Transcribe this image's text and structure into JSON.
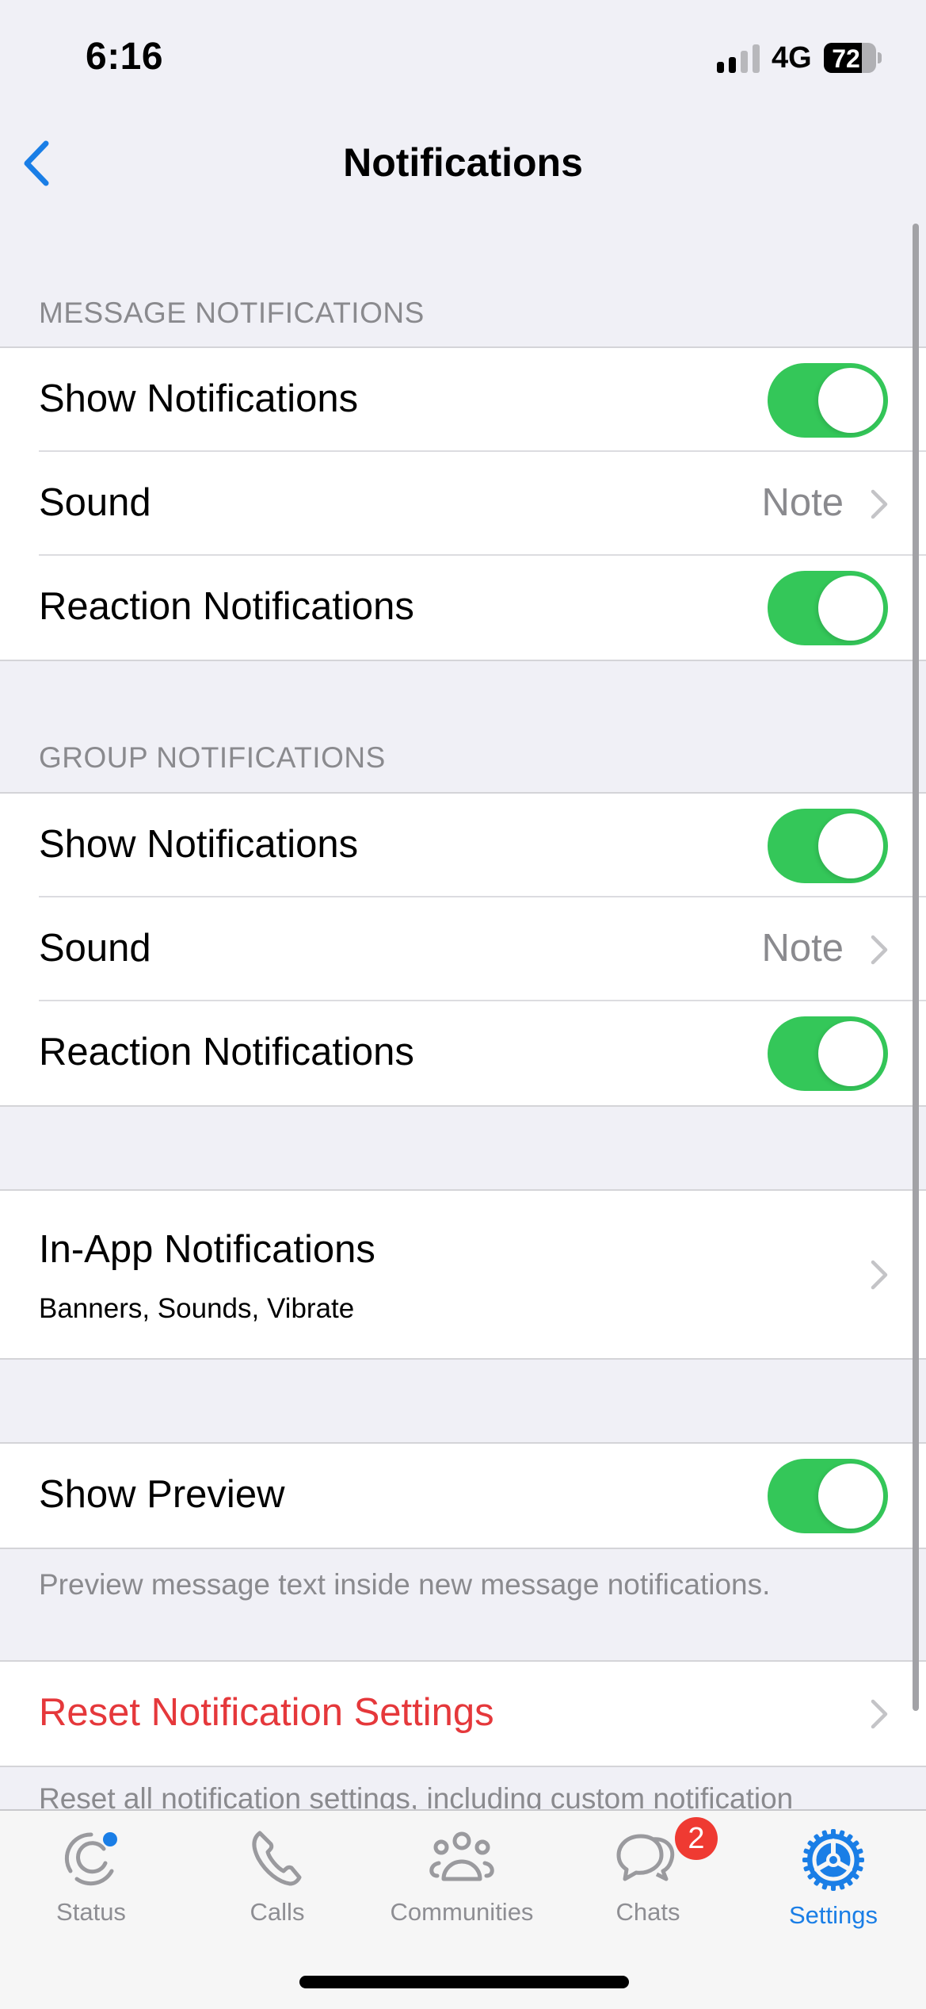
{
  "status_bar": {
    "time": "6:16",
    "network": "4G",
    "signal_bars_active": 2,
    "signal_bars_total": 4,
    "battery_percent": 72,
    "battery_label": "72"
  },
  "nav": {
    "back_icon": "chevron-left-icon",
    "title": "Notifications"
  },
  "colors": {
    "accent": "#1a7ee6",
    "toggle_on": "#34c759",
    "destructive": "#e5383b",
    "secondary_text": "#8a8a8e",
    "badge": "#ef3a32"
  },
  "message_notifications": {
    "header": "MESSAGE NOTIFICATIONS",
    "rows": [
      {
        "label": "Show Notifications",
        "type": "toggle",
        "on": true
      },
      {
        "label": "Sound",
        "type": "value",
        "value": "Note"
      },
      {
        "label": "Reaction Notifications",
        "type": "toggle",
        "on": true
      }
    ]
  },
  "group_notifications": {
    "header": "GROUP NOTIFICATIONS",
    "rows": [
      {
        "label": "Show Notifications",
        "type": "toggle",
        "on": true
      },
      {
        "label": "Sound",
        "type": "value",
        "value": "Note"
      },
      {
        "label": "Reaction Notifications",
        "type": "toggle",
        "on": true
      }
    ]
  },
  "in_app": {
    "label": "In-App Notifications",
    "subtitle": "Banners, Sounds, Vibrate"
  },
  "preview": {
    "label": "Show Preview",
    "on": true,
    "footer": "Preview message text inside new message notifications."
  },
  "reset": {
    "label": "Reset Notification Settings",
    "footer": "Reset all notification settings, including custom notification"
  },
  "tabbar": {
    "tabs": [
      {
        "label": "Status",
        "icon": "status-icon",
        "active": false,
        "dot": true
      },
      {
        "label": "Calls",
        "icon": "phone-icon",
        "active": false
      },
      {
        "label": "Communities",
        "icon": "communities-icon",
        "active": false
      },
      {
        "label": "Chats",
        "icon": "chats-icon",
        "active": false,
        "badge": "2"
      },
      {
        "label": "Settings",
        "icon": "gear-icon",
        "active": true
      }
    ]
  }
}
